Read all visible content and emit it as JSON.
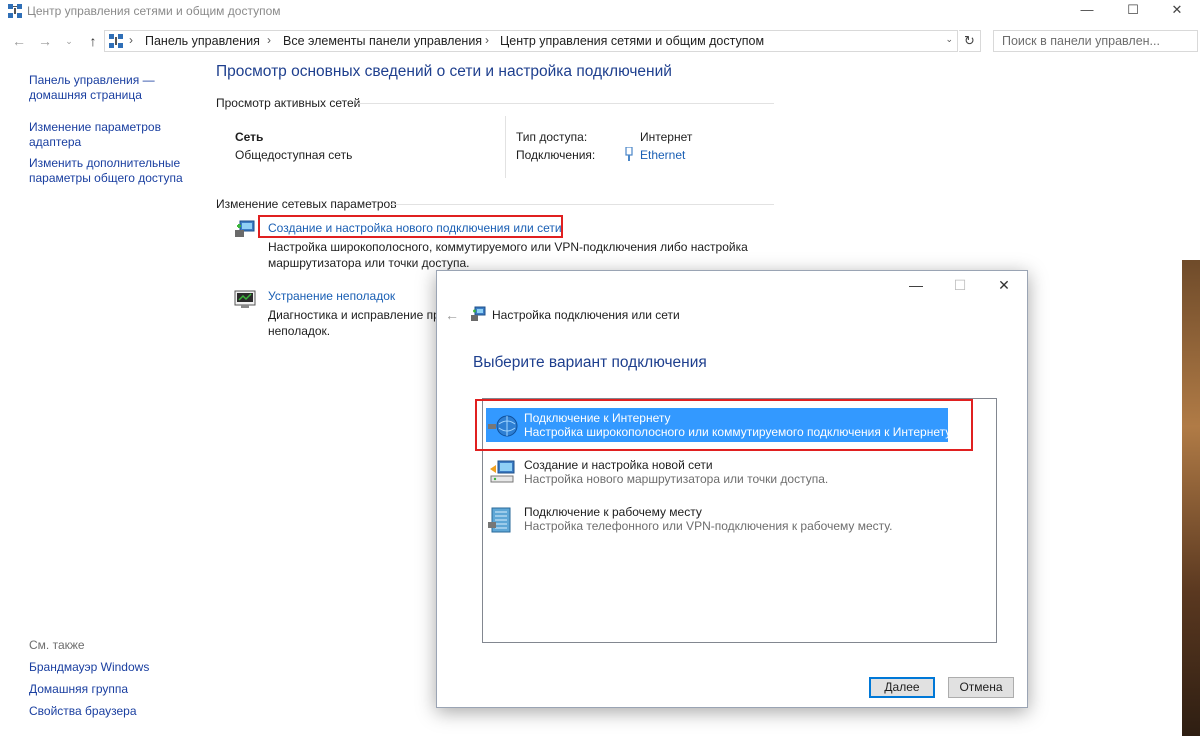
{
  "window": {
    "title": "Центр управления сетями и общим доступом",
    "min": "—",
    "max": "☐",
    "close": "✕"
  },
  "address": {
    "back": "←",
    "forward": "→",
    "dropdown": "⌄",
    "up": "↑",
    "crumbs": [
      "Панель управления",
      "Все элементы панели управления",
      "Центр управления сетями и общим доступом"
    ],
    "separator": "›",
    "refresh": "↻",
    "search_placeholder": "Поиск в панели управлен..."
  },
  "sidebar": {
    "home": "Панель управления — домашняя страница",
    "links": [
      "Изменение параметров адаптера",
      "Изменить дополнительные параметры общего доступа"
    ],
    "see_also_label": "См. также",
    "see_also": [
      "Брандмауэр Windows",
      "Домашняя группа",
      "Свойства браузера"
    ]
  },
  "main": {
    "title": "Просмотр основных сведений о сети и настройка подключений",
    "active_header": "Просмотр активных сетей",
    "network_name": "Сеть",
    "network_type": "Общедоступная сеть",
    "access_label": "Тип доступа:",
    "access_value": "Интернет",
    "connections_label": "Подключения:",
    "connection_value": "Ethernet",
    "change_header": "Изменение сетевых параметров",
    "tasks": [
      {
        "link": "Создание и настройка нового подключения или сети",
        "desc1": "Настройка широкополосного, коммутируемого или VPN-подключения либо настройка",
        "desc2": "маршрутизатора или точки доступа."
      },
      {
        "link": "Устранение неполадок",
        "desc1": "Диагностика и исправление пр",
        "desc2": "неполадок."
      }
    ]
  },
  "dialog": {
    "title": "Настройка подключения или сети",
    "heading": "Выберите вариант подключения",
    "back": "←",
    "min": "—",
    "max": "☐",
    "close": "✕",
    "options": [
      {
        "title": "Подключение к Интернету",
        "desc": "Настройка широкополосного или коммутируемого подключения к Интернету.",
        "icon": "globe-icon"
      },
      {
        "title": "Создание и настройка новой сети",
        "desc": "Настройка нового маршрутизатора или точки доступа.",
        "icon": "router-icon"
      },
      {
        "title": "Подключение к рабочему месту",
        "desc": "Настройка телефонного или VPN-подключения к рабочему месту.",
        "icon": "workplace-icon"
      }
    ],
    "next_label": "Далее",
    "cancel_label": "Отмена"
  },
  "colors": {
    "link": "#1a5fb4",
    "heading": "#1e3f8e",
    "selection": "#3399ff",
    "highlight_box": "#e02020"
  }
}
